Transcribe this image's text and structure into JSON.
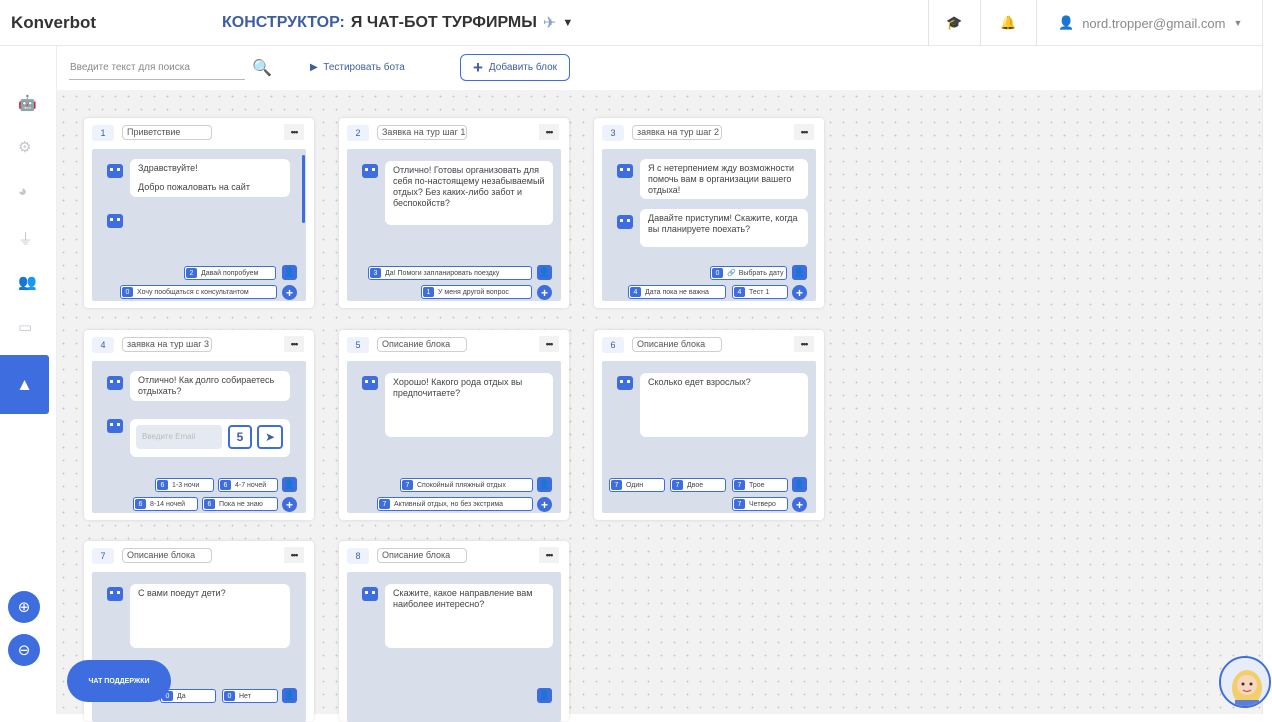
{
  "header": {
    "logo": "Konverbot",
    "title_prefix": "КОНСТРУКТОР:",
    "title_bot": "Я ЧАТ-БОТ ТУРФИРМЫ",
    "user_email": "nord.tropper@gmail.com"
  },
  "toolbar": {
    "search_placeholder": "Введите текст для поиска",
    "test_label": "Тестировать бота",
    "add_label": "Добавить блок"
  },
  "support_label": "ЧАТ ПОДДЕРЖКИ",
  "blocks": [
    {
      "num": "1",
      "name": "Приветствие",
      "messages": [
        "Здравствуйте!",
        "Добро пожаловать на сайт"
      ],
      "buttons": [
        {
          "n": "2",
          "label": "Давай попробуем"
        },
        {
          "n": "0",
          "label": "Хочу пообщаться с консультантом"
        }
      ]
    },
    {
      "num": "2",
      "name": "Заявка на тур шаг 1",
      "messages": [
        "Отлично! Готовы организовать для себя по-настоящему незабываемый отдых? Без каких-либо забот и беспокойств?"
      ],
      "buttons": [
        {
          "n": "3",
          "label": "Да! Помоги запланировать поездку"
        },
        {
          "n": "1",
          "label": "У меня другой вопрос"
        }
      ]
    },
    {
      "num": "3",
      "name": "заявка на тур шаг 2",
      "messages": [
        "Я с нетерпением жду возможности помочь вам в организации вашего отдыха!",
        "Давайте приступим! Скажите, когда вы планируете поехать?"
      ],
      "buttons": [
        {
          "n": "0",
          "label": "Выбрать дату"
        },
        {
          "n": "4",
          "label": "Дата пока не важна"
        },
        {
          "n": "4",
          "label": "Тест 1"
        }
      ]
    },
    {
      "num": "4",
      "name": "заявка на тур шаг 3",
      "messages": [
        "Отлично! Как долго собираетесь отдыхать?"
      ],
      "email_placeholder": "Введите Email",
      "email_num": "5",
      "buttons": [
        {
          "n": "6",
          "label": "1-3 ночи"
        },
        {
          "n": "6",
          "label": "4-7 ночей"
        },
        {
          "n": "6",
          "label": "8-14 ночей"
        },
        {
          "n": "6",
          "label": "Пока не знаю"
        }
      ]
    },
    {
      "num": "5",
      "name": "Описание блока",
      "messages": [
        "Хорошо! Какого рода отдых вы предпочитаете?"
      ],
      "buttons": [
        {
          "n": "7",
          "label": "Спокойный пляжный отдых"
        },
        {
          "n": "7",
          "label": "Активный отдых, но без экстрима"
        }
      ]
    },
    {
      "num": "6",
      "name": "Описание блока",
      "messages": [
        "Сколько едет взрослых?"
      ],
      "buttons": [
        {
          "n": "7",
          "label": "Один"
        },
        {
          "n": "7",
          "label": "Двое"
        },
        {
          "n": "7",
          "label": "Трое"
        },
        {
          "n": "7",
          "label": "Четверо"
        }
      ]
    },
    {
      "num": "7",
      "name": "Описание блока",
      "messages": [
        "С вами поедут дети?"
      ],
      "buttons": [
        {
          "n": "0",
          "label": "Да"
        },
        {
          "n": "0",
          "label": "Нет"
        }
      ]
    },
    {
      "num": "8",
      "name": "Описание блока",
      "messages": [
        "Скажите, какое направление вам наиболее интересно?"
      ],
      "buttons": []
    }
  ]
}
